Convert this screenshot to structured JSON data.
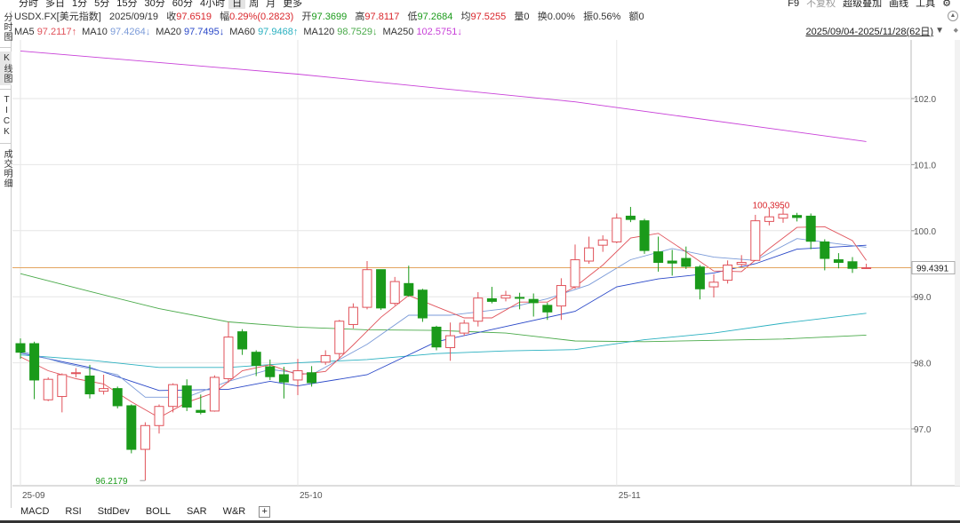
{
  "toolbar": {
    "periods": [
      "分时",
      "多日",
      "1分",
      "5分",
      "15分",
      "30分",
      "60分",
      "4小时",
      "日",
      "周",
      "月",
      "更多"
    ],
    "active_period": "日",
    "right_links": [
      "F9",
      "不复权",
      "超级叠加",
      "画线",
      "工具"
    ]
  },
  "sidebar": {
    "tabs": [
      "分时图",
      "K线图",
      "TICK",
      "成交明细"
    ]
  },
  "quote": {
    "symbol": "USDX.FX[美元指数]",
    "date": "2025/09/19",
    "close_label": "收",
    "close": "97.6519",
    "change_label": "幅",
    "change": "0.29%(0.2823)",
    "open_label": "开",
    "open": "97.3699",
    "high_label": "高",
    "high": "97.8117",
    "low_label": "低",
    "low": "97.2684",
    "avg_label": "均",
    "avg": "97.5255",
    "vol_label": "量",
    "vol": "0",
    "turnover_label": "换",
    "turnover": "0.00%",
    "amp_label": "振",
    "amp": "0.56%",
    "amount_label": "额",
    "amount": "0"
  },
  "ma_legend": [
    {
      "label": "MA5",
      "value": "97.2117↑",
      "color": "#e0525a"
    },
    {
      "label": "MA10",
      "value": "97.4264↓",
      "color": "#7a9ad8"
    },
    {
      "label": "MA20",
      "value": "97.7495↓",
      "color": "#2a48c8"
    },
    {
      "label": "MA60",
      "value": "97.9468↑",
      "color": "#2ab0c0"
    },
    {
      "label": "MA120",
      "value": "98.7529↓",
      "color": "#4aaa4a"
    },
    {
      "label": "MA250",
      "value": "102.5751↓",
      "color": "#c840d8"
    }
  ],
  "range_text": "2025/09/04-2025/11/28(62日)",
  "colors": {
    "up": "#e0525a",
    "down": "#1a9a1a",
    "current_line": "#e3a560",
    "grid": "#e6e6e6",
    "axis_text": "#555555"
  },
  "bottom_tabs": [
    "MACD",
    "RSI",
    "StdDev",
    "BOLL",
    "SAR",
    "W&R"
  ],
  "chart_data": {
    "type": "candlestick",
    "ylim": [
      96.1,
      102.9
    ],
    "y_ticks": [
      "97.0",
      "98.0",
      "99.0",
      "100.0",
      "101.0",
      "102.0"
    ],
    "x_labels": [
      {
        "index": 0,
        "label": "25-09"
      },
      {
        "index": 20,
        "label": "25-10"
      },
      {
        "index": 43,
        "label": "25-11"
      }
    ],
    "current_price": "99.4391",
    "annotations": [
      {
        "index": 9,
        "price": 96.2179,
        "label": "96.2179",
        "color": "#1a9a1a"
      },
      {
        "index": 56,
        "price": 100.395,
        "label": "100.3950",
        "color": "#d9252b"
      }
    ],
    "candles": [
      [
        98.29,
        98.16,
        98.37,
        98.06
      ],
      [
        98.29,
        97.74,
        98.32,
        97.45
      ],
      [
        97.44,
        97.75,
        97.78,
        97.42
      ],
      [
        97.49,
        97.82,
        97.84,
        97.25
      ],
      [
        97.84,
        97.85,
        97.92,
        97.78
      ],
      [
        97.8,
        97.53,
        97.97,
        97.46
      ],
      [
        97.57,
        97.61,
        97.82,
        97.52
      ],
      [
        97.61,
        97.35,
        97.64,
        97.31
      ],
      [
        97.35,
        96.69,
        97.37,
        96.63
      ],
      [
        96.69,
        97.05,
        97.1,
        96.22
      ],
      [
        97.05,
        97.34,
        97.37,
        96.93
      ],
      [
        97.34,
        97.67,
        97.69,
        97.25
      ],
      [
        97.65,
        97.33,
        97.75,
        97.27
      ],
      [
        97.28,
        97.25,
        97.52,
        97.22
      ],
      [
        97.27,
        97.78,
        97.81,
        97.26
      ],
      [
        97.76,
        98.39,
        98.62,
        97.7
      ],
      [
        98.47,
        98.21,
        98.51,
        98.12
      ],
      [
        98.16,
        97.96,
        98.19,
        97.8
      ],
      [
        97.94,
        97.79,
        98.05,
        97.74
      ],
      [
        97.82,
        97.71,
        97.94,
        97.46
      ],
      [
        97.74,
        97.88,
        98.06,
        97.51
      ],
      [
        97.85,
        97.7,
        97.95,
        97.64
      ],
      [
        98.01,
        98.11,
        98.19,
        97.97
      ],
      [
        98.14,
        98.63,
        98.65,
        98.06
      ],
      [
        98.58,
        98.84,
        98.9,
        98.52
      ],
      [
        98.84,
        99.41,
        99.54,
        98.81
      ],
      [
        99.41,
        98.83,
        99.41,
        98.8
      ],
      [
        98.9,
        99.23,
        99.3,
        98.87
      ],
      [
        99.2,
        99.02,
        99.47,
        99.0
      ],
      [
        99.1,
        98.68,
        99.12,
        98.62
      ],
      [
        98.54,
        98.24,
        98.56,
        98.19
      ],
      [
        98.23,
        98.41,
        98.61,
        98.03
      ],
      [
        98.45,
        98.6,
        98.65,
        98.41
      ],
      [
        98.63,
        98.98,
        99.07,
        98.55
      ],
      [
        98.97,
        98.93,
        99.15,
        98.9
      ],
      [
        98.98,
        99.02,
        99.09,
        98.93
      ],
      [
        98.99,
        98.98,
        99.06,
        98.81
      ],
      [
        98.96,
        98.91,
        99.05,
        98.7
      ],
      [
        98.87,
        98.77,
        98.91,
        98.65
      ],
      [
        98.86,
        99.17,
        99.28,
        98.65
      ],
      [
        99.15,
        99.56,
        99.79,
        99.12
      ],
      [
        99.54,
        99.74,
        99.91,
        99.5
      ],
      [
        99.78,
        99.86,
        99.93,
        99.68
      ],
      [
        99.83,
        100.19,
        100.26,
        99.81
      ],
      [
        100.22,
        100.17,
        100.36,
        100.13
      ],
      [
        100.15,
        99.7,
        100.18,
        99.65
      ],
      [
        99.68,
        99.52,
        99.91,
        99.38
      ],
      [
        99.54,
        99.51,
        99.71,
        99.32
      ],
      [
        99.58,
        99.46,
        99.76,
        99.42
      ],
      [
        99.45,
        99.12,
        99.48,
        98.96
      ],
      [
        99.15,
        99.22,
        99.34,
        98.99
      ],
      [
        99.25,
        99.48,
        99.55,
        99.2
      ],
      [
        99.49,
        99.52,
        99.63,
        99.45
      ],
      [
        99.55,
        100.15,
        100.24,
        99.54
      ],
      [
        100.14,
        100.21,
        100.35,
        100.08
      ],
      [
        100.19,
        100.25,
        100.36,
        100.12
      ],
      [
        100.23,
        100.2,
        100.27,
        100.14
      ],
      [
        100.22,
        99.84,
        100.26,
        99.72
      ],
      [
        99.83,
        99.58,
        99.87,
        99.4
      ],
      [
        99.56,
        99.52,
        99.66,
        99.43
      ],
      [
        99.53,
        99.43,
        99.6,
        99.36
      ],
      [
        99.44,
        99.44,
        99.5,
        99.42
      ]
    ],
    "ma_series": [
      {
        "name": "MA250",
        "color": "#c840d8",
        "points": [
          [
            0,
            102.72
          ],
          [
            20,
            102.37
          ],
          [
            40,
            101.95
          ],
          [
            61,
            101.35
          ]
        ]
      },
      {
        "name": "MA120",
        "color": "#4aaa4a",
        "points": [
          [
            0,
            99.35
          ],
          [
            5,
            99.08
          ],
          [
            10,
            98.82
          ],
          [
            15,
            98.62
          ],
          [
            20,
            98.54
          ],
          [
            25,
            98.5
          ],
          [
            30,
            98.49
          ],
          [
            35,
            98.45
          ],
          [
            40,
            98.33
          ],
          [
            45,
            98.32
          ],
          [
            50,
            98.34
          ],
          [
            55,
            98.36
          ],
          [
            61,
            98.42
          ]
        ]
      },
      {
        "name": "MA60",
        "color": "#2ab0c0",
        "points": [
          [
            0,
            98.12
          ],
          [
            5,
            98.04
          ],
          [
            10,
            97.93
          ],
          [
            15,
            97.93
          ],
          [
            20,
            98.0
          ],
          [
            25,
            98.05
          ],
          [
            30,
            98.14
          ],
          [
            35,
            98.18
          ],
          [
            40,
            98.2
          ],
          [
            45,
            98.35
          ],
          [
            50,
            98.45
          ],
          [
            55,
            98.6
          ],
          [
            61,
            98.75
          ]
        ]
      },
      {
        "name": "MA20",
        "color": "#2a48c8",
        "points": [
          [
            0,
            98.15
          ],
          [
            5,
            97.93
          ],
          [
            10,
            97.58
          ],
          [
            15,
            97.6
          ],
          [
            18,
            97.72
          ],
          [
            20,
            97.65
          ],
          [
            25,
            97.82
          ],
          [
            30,
            98.32
          ],
          [
            35,
            98.55
          ],
          [
            40,
            98.78
          ],
          [
            43,
            99.15
          ],
          [
            46,
            99.27
          ],
          [
            50,
            99.36
          ],
          [
            53,
            99.5
          ],
          [
            56,
            99.72
          ],
          [
            61,
            99.78
          ]
        ]
      },
      {
        "name": "MA10",
        "color": "#7a9ad8",
        "points": [
          [
            0,
            98.18
          ],
          [
            3,
            98.0
          ],
          [
            7,
            97.82
          ],
          [
            9,
            97.48
          ],
          [
            12,
            97.48
          ],
          [
            15,
            97.72
          ],
          [
            18,
            97.9
          ],
          [
            21,
            97.82
          ],
          [
            25,
            98.28
          ],
          [
            28,
            98.72
          ],
          [
            31,
            98.72
          ],
          [
            35,
            98.82
          ],
          [
            38,
            98.97
          ],
          [
            41,
            99.18
          ],
          [
            44,
            99.56
          ],
          [
            47,
            99.73
          ],
          [
            50,
            99.6
          ],
          [
            53,
            99.55
          ],
          [
            56,
            99.88
          ],
          [
            59,
            99.8
          ],
          [
            61,
            99.75
          ]
        ]
      },
      {
        "name": "MA5",
        "color": "#e0525a",
        "points": [
          [
            0,
            98.09
          ],
          [
            2,
            97.88
          ],
          [
            4,
            97.76
          ],
          [
            6,
            97.68
          ],
          [
            8,
            97.41
          ],
          [
            10,
            97.17
          ],
          [
            12,
            97.4
          ],
          [
            14,
            97.55
          ],
          [
            16,
            97.88
          ],
          [
            18,
            97.97
          ],
          [
            20,
            97.82
          ],
          [
            22,
            97.87
          ],
          [
            24,
            98.27
          ],
          [
            26,
            98.69
          ],
          [
            28,
            99.02
          ],
          [
            30,
            98.85
          ],
          [
            32,
            98.68
          ],
          [
            34,
            98.68
          ],
          [
            36,
            98.92
          ],
          [
            38,
            98.92
          ],
          [
            40,
            99.15
          ],
          [
            42,
            99.48
          ],
          [
            44,
            99.89
          ],
          [
            46,
            99.96
          ],
          [
            48,
            99.68
          ],
          [
            50,
            99.39
          ],
          [
            52,
            99.38
          ],
          [
            54,
            99.73
          ],
          [
            56,
            100.05
          ],
          [
            58,
            100.06
          ],
          [
            60,
            99.85
          ],
          [
            61,
            99.55
          ]
        ]
      }
    ]
  }
}
